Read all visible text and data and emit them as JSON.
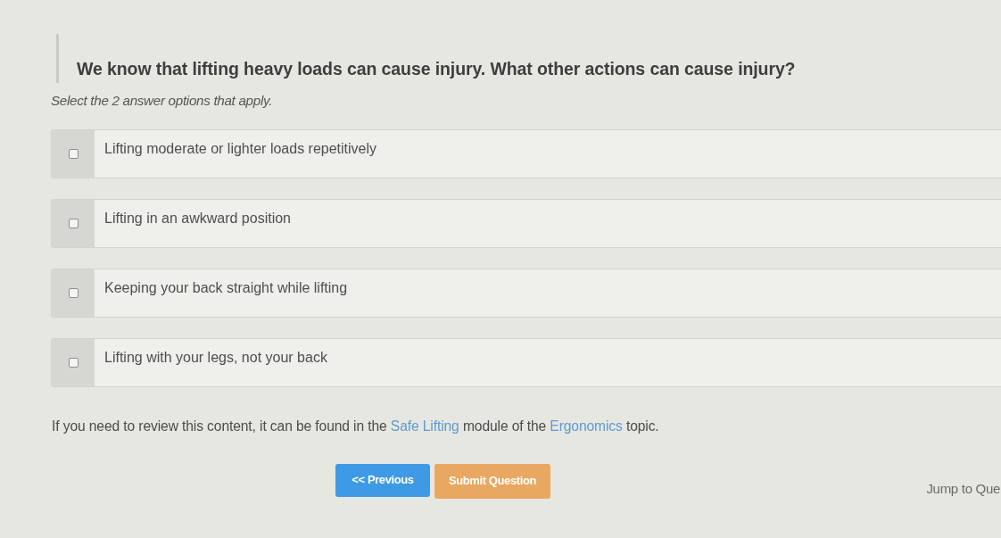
{
  "question": {
    "title": "We know that lifting heavy loads can cause injury. What other actions can cause injury?",
    "instruction": "Select the 2 answer options that apply."
  },
  "options": [
    {
      "label": "Lifting moderate or lighter loads repetitively",
      "checked": false
    },
    {
      "label": "Lifting in an awkward position",
      "checked": false
    },
    {
      "label": "Keeping your back straight while lifting",
      "checked": false
    },
    {
      "label": "Lifting with your legs, not your back",
      "checked": false
    }
  ],
  "review_note": [
    {
      "kind": "text",
      "text": "If you need to review this content, it can be found in the "
    },
    {
      "kind": "link",
      "text": "Safe Lifting"
    },
    {
      "kind": "text",
      "text": " module of the "
    },
    {
      "kind": "link",
      "text": "Ergonomics"
    },
    {
      "kind": "text",
      "text": " topic."
    }
  ],
  "buttons": [
    {
      "kind": "previous",
      "label": "<< Previous"
    },
    {
      "kind": "submit",
      "label": "Submit Question"
    }
  ],
  "jump_link": "Jump to Que"
}
